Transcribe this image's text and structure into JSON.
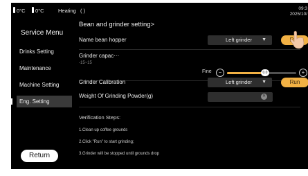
{
  "status_bar": {
    "temp1": "0°C",
    "temp2": "0°C",
    "state": "Heating",
    "time": "09:3",
    "date": "2025/10/"
  },
  "sidebar": {
    "title": "Service Menu",
    "items": [
      {
        "label": "Drinks Setting",
        "active": false
      },
      {
        "label": "Maintenance",
        "active": false
      },
      {
        "label": "Machine Setting",
        "active": false
      },
      {
        "label": "Eng. Setting",
        "active": true
      }
    ],
    "return_label": "Return"
  },
  "main": {
    "title": "Bean and grinder setting>",
    "hopper": {
      "label": "Name bean hopper",
      "selected": "Left grinder",
      "run_label": "Run"
    },
    "grinder_capacity": {
      "label": "Grinder capac···",
      "range": "-15~15",
      "fine_label": "Fine",
      "value": "0.0",
      "level": 0.55
    },
    "calibration": {
      "label": "Grinder Calibration",
      "selected": "Left grinder",
      "run_label": "Run"
    },
    "weight": {
      "label": "Weight Of Grinding Powder(g)",
      "value": ""
    },
    "verification": {
      "title": "Verification Steps:",
      "steps": [
        "1.Clean up coffee grounds",
        "2.Click \"Run\" to start grinding;",
        "3.Grinder will be stopped until grounds drop"
      ]
    }
  },
  "colors": {
    "background": "#000000",
    "accent": "#f2b144",
    "control": "#2e2e2e",
    "active_item": "#3a3a3a"
  }
}
